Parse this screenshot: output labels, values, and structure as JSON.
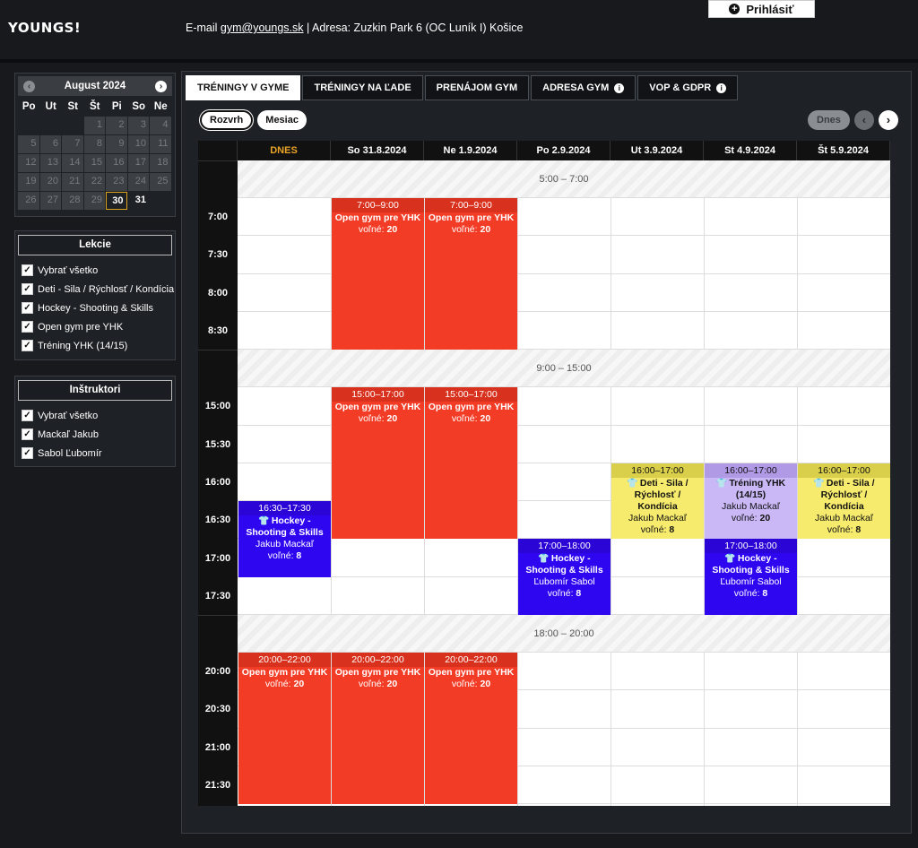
{
  "header": {
    "logo": "YOUNGS!",
    "contact_prefix": "E-mail ",
    "email": "gym@youngs.sk",
    "contact_suffix": " | Adresa: Zuzkin Park 6 (OC Luník I) Košice",
    "login_label": "Prihlásiť"
  },
  "calendar": {
    "month_label": "August 2024",
    "weekdays": [
      "Po",
      "Ut",
      "St",
      "Št",
      "Pi",
      "So",
      "Ne"
    ],
    "days": [
      "",
      "",
      "",
      "1",
      "2",
      "3",
      "4",
      "5",
      "6",
      "7",
      "8",
      "9",
      "10",
      "11",
      "12",
      "13",
      "14",
      "15",
      "16",
      "17",
      "18",
      "19",
      "20",
      "21",
      "22",
      "23",
      "24",
      "25",
      "26",
      "27",
      "28",
      "29",
      "30",
      "31"
    ],
    "today": "30"
  },
  "lekcie": {
    "title": "Lekcie",
    "items": [
      "Vybrať všetko",
      "Deti - Sila / Rýchlosť / Kondícia",
      "Hockey - Shooting & Skills",
      "Open gym pre YHK",
      "Tréning YHK (14/15)"
    ]
  },
  "instruktori": {
    "title": "Inštruktori",
    "items": [
      "Vybrať všetko",
      "Mackaľ Jakub",
      "Sabol Ľubomír"
    ]
  },
  "tabs": [
    {
      "label": "TRÉNINGY V GYME",
      "info": false
    },
    {
      "label": "TRÉNINGY NA ĽADE",
      "info": false
    },
    {
      "label": "PRENÁJOM GYM",
      "info": false
    },
    {
      "label": "ADRESA GYM",
      "info": true
    },
    {
      "label": "VOP & GDPR",
      "info": true
    }
  ],
  "views": {
    "rozvrh": "Rozvrh",
    "mesiac": "Mesiac"
  },
  "nav": {
    "dnes": "Dnes",
    "prev": "‹",
    "next": "›"
  },
  "columns": [
    "DNES",
    "So 31.8.2024",
    "Ne 1.9.2024",
    "Po 2.9.2024",
    "Ut 3.9.2024",
    "St 4.9.2024",
    "Št 5.9.2024"
  ],
  "gaps": [
    "5:00 – 7:00",
    "9:00 – 15:00",
    "18:00 – 20:00"
  ],
  "times": [
    "7:00",
    "7:30",
    "8:00",
    "8:30",
    "15:00",
    "15:30",
    "16:00",
    "16:30",
    "17:00",
    "17:30",
    "20:00",
    "20:30",
    "21:00",
    "21:30"
  ],
  "events": [
    {
      "col": 1,
      "start": 0,
      "span": 4,
      "color": "red",
      "time": "7:00–9:00",
      "title": "Open gym pre YHK",
      "instructor": "",
      "free": "20",
      "person": false
    },
    {
      "col": 2,
      "start": 0,
      "span": 4,
      "color": "red",
      "time": "7:00–9:00",
      "title": "Open gym pre YHK",
      "instructor": "",
      "free": "20",
      "person": false
    },
    {
      "col": 1,
      "start": 4,
      "span": 4,
      "color": "red",
      "time": "15:00–17:00",
      "title": "Open gym pre YHK",
      "instructor": "",
      "free": "20",
      "person": false
    },
    {
      "col": 2,
      "start": 4,
      "span": 4,
      "color": "red",
      "time": "15:00–17:00",
      "title": "Open gym pre YHK",
      "instructor": "",
      "free": "20",
      "person": false
    },
    {
      "col": 0,
      "start": 7,
      "span": 2,
      "color": "blue",
      "time": "16:30–17:30",
      "title": "Hockey - Shooting & Skills",
      "instructor": "Jakub Mackaľ",
      "free": "8",
      "person": true
    },
    {
      "col": 3,
      "start": 8,
      "span": 2,
      "color": "blue",
      "time": "17:00–18:00",
      "title": "Hockey - Shooting & Skills",
      "instructor": "Ľubomír Sabol",
      "free": "8",
      "person": true
    },
    {
      "col": 4,
      "start": 6,
      "span": 2,
      "color": "yellow",
      "time": "16:00–17:00",
      "title": "Deti - Sila / Rýchlosť / Kondícia",
      "instructor": "Jakub Mackaľ",
      "free": "8",
      "person": true
    },
    {
      "col": 5,
      "start": 6,
      "span": 2,
      "color": "purple",
      "time": "16:00–17:00",
      "title": "Tréning YHK (14/15)",
      "instructor": "Jakub Mackaľ",
      "free": "20",
      "person": true
    },
    {
      "col": 6,
      "start": 6,
      "span": 2,
      "color": "yellow",
      "time": "16:00–17:00",
      "title": "Deti - Sila / Rýchlosť / Kondícia",
      "instructor": "Jakub Mackaľ",
      "free": "8",
      "person": true
    },
    {
      "col": 5,
      "start": 8,
      "span": 2,
      "color": "blue",
      "time": "17:00–18:00",
      "title": "Hockey - Shooting & Skills",
      "instructor": "Ľubomír Sabol",
      "free": "8",
      "person": true
    },
    {
      "col": 0,
      "start": 10,
      "span": 4,
      "color": "red",
      "time": "20:00–22:00",
      "title": "Open gym pre YHK",
      "instructor": "",
      "free": "20",
      "person": false
    },
    {
      "col": 1,
      "start": 10,
      "span": 4,
      "color": "red",
      "time": "20:00–22:00",
      "title": "Open gym pre YHK",
      "instructor": "",
      "free": "20",
      "person": false
    },
    {
      "col": 2,
      "start": 10,
      "span": 4,
      "color": "red",
      "time": "20:00–22:00",
      "title": "Open gym pre YHK",
      "instructor": "",
      "free": "20",
      "person": false
    }
  ],
  "free_label": "voľné:"
}
